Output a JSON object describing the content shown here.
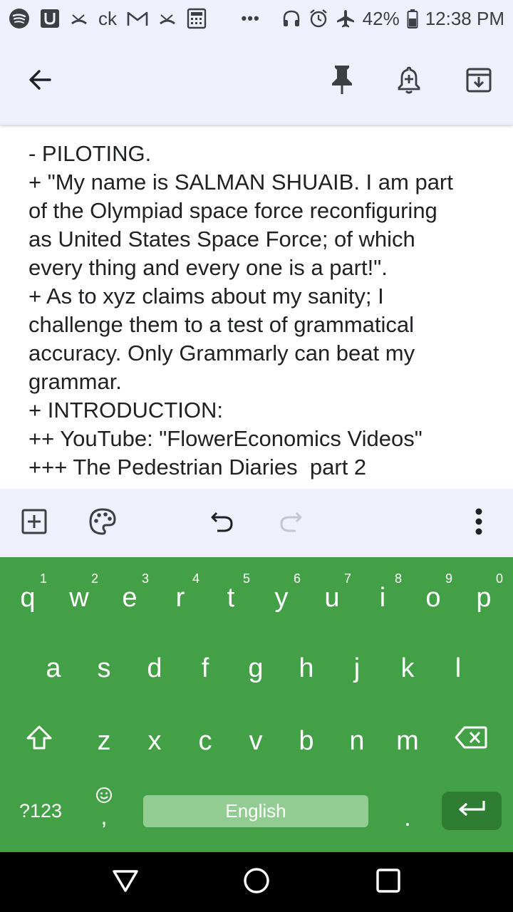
{
  "status_bar": {
    "battery_percent": "42%",
    "time": "12:38 PM",
    "carrier_text": "ck",
    "more_glyph": "•••",
    "left_icons": [
      "spotify-icon",
      "u-app-icon",
      "missed-call-icon",
      "ck-app-icon",
      "gmail-icon",
      "missed-call-icon",
      "calculator-icon"
    ],
    "right_icons": [
      "headset-icon",
      "alarm-icon",
      "airplane-icon",
      "battery-icon"
    ]
  },
  "app_bar": {
    "icons": [
      "back-arrow-icon",
      "pin-icon",
      "add-reminder-icon",
      "archive-icon"
    ],
    "accent_color": "#3c4043"
  },
  "note": {
    "lines": [
      "- PILOTING.",
      "+ \"My name is SALMAN SHUAIB. I am part",
      "of the Olympiad space force reconfiguring",
      "as United States Space Force; of which",
      "every thing and every one is a part!\".",
      "+ As to xyz claims about my sanity; I",
      "challenge them to a test of grammatical",
      "accuracy. Only Grammarly can beat my",
      "grammar.",
      "+ INTRODUCTION:",
      "++ YouTube: \"FlowerEconomics Videos\"",
      "+++ The Pedestrian Diaries  part 2"
    ]
  },
  "editor_toolbar": {
    "icons": [
      "add-box-icon",
      "palette-icon",
      "undo-icon",
      "redo-icon",
      "more-vert-icon"
    ]
  },
  "keyboard": {
    "background_color": "#43a047",
    "row1": [
      {
        "letter": "q",
        "hint": "1"
      },
      {
        "letter": "w",
        "hint": "2"
      },
      {
        "letter": "e",
        "hint": "3"
      },
      {
        "letter": "r",
        "hint": "4"
      },
      {
        "letter": "t",
        "hint": "5"
      },
      {
        "letter": "y",
        "hint": "6"
      },
      {
        "letter": "u",
        "hint": "7"
      },
      {
        "letter": "i",
        "hint": "8"
      },
      {
        "letter": "o",
        "hint": "9"
      },
      {
        "letter": "p",
        "hint": "0"
      }
    ],
    "row2": [
      "a",
      "s",
      "d",
      "f",
      "g",
      "h",
      "j",
      "k",
      "l"
    ],
    "row3": [
      "z",
      "x",
      "c",
      "v",
      "b",
      "n",
      "m"
    ],
    "symbols_label": "?123",
    "emoji_comma_label": ",",
    "space_label": "English",
    "period_label": ".",
    "special_icons": [
      "shift-icon",
      "backspace-icon",
      "emoji-icon",
      "enter-icon"
    ]
  },
  "nav_bar": {
    "icons": [
      "back-triangle-icon",
      "home-circle-icon",
      "recents-square-icon"
    ]
  }
}
